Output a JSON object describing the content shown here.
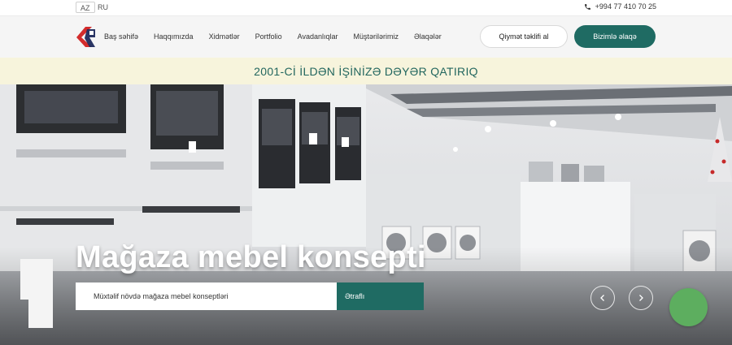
{
  "topbar": {
    "languages": [
      {
        "code": "AZ",
        "active": true
      },
      {
        "code": "RU",
        "active": false
      }
    ],
    "phone": "+994 77 410 70 25",
    "phone_icon": "phone-icon"
  },
  "header": {
    "logo_icon": "company-logo",
    "nav": [
      "Baş səhifə",
      "Haqqımızda",
      "Xidmətlər",
      "Portfolio",
      "Avadanlıqlar",
      "Müştərilərimiz",
      "Əlaqələr"
    ],
    "quote_button": "Qiymət təklifi al",
    "contact_button": "Bizimlə əlaqə"
  },
  "band": {
    "slogan": "2001-Cİ İLDƏN İŞİNİZƏ DƏYƏR QATIRIQ"
  },
  "hero": {
    "title": "Mağaza mebel konsepti",
    "subtitle": "Müxtəlif növdə mağaza mebel konseptləri",
    "more_button": "Ətraflı",
    "prev_icon": "chevron-left-icon",
    "next_icon": "chevron-right-icon",
    "chat_icon": "chat-widget-icon"
  },
  "colors": {
    "accent": "#1f6b63",
    "band_bg": "#f7f4dc",
    "chat_green": "#5dae5f"
  }
}
